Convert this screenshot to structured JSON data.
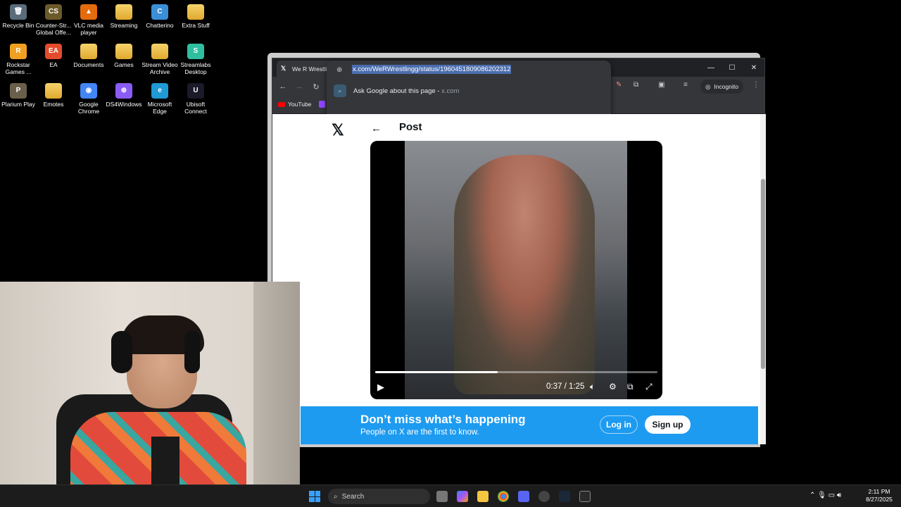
{
  "desktop": {
    "icons": [
      {
        "label": "Recycle Bin",
        "glyph": "🗑"
      },
      {
        "label": "Counter-Str... Global Offe...",
        "glyph": "CS"
      },
      {
        "label": "VLC media player",
        "glyph": "▲"
      },
      {
        "label": "Streaming",
        "glyph": ""
      },
      {
        "label": "Chatterino",
        "glyph": "C"
      },
      {
        "label": "Extra Stuff",
        "glyph": ""
      },
      {
        "label": "Rockstar Games ...",
        "glyph": "R"
      },
      {
        "label": "EA",
        "glyph": "EA"
      },
      {
        "label": "Documents",
        "glyph": ""
      },
      {
        "label": "Games",
        "glyph": ""
      },
      {
        "label": "Stream Video Archive",
        "glyph": ""
      },
      {
        "label": "Streamlabs Desktop",
        "glyph": "S"
      },
      {
        "label": "Plarium Play",
        "glyph": "P"
      },
      {
        "label": "Emotes",
        "glyph": ""
      },
      {
        "label": "Google Chrome",
        "glyph": "◉"
      },
      {
        "label": "DS4Windows",
        "glyph": "⊕"
      },
      {
        "label": "Microsoft Edge",
        "glyph": "e"
      },
      {
        "label": "Ubisoft Connect",
        "glyph": "U"
      }
    ]
  },
  "browser": {
    "tab_title": "We R Wrestling on X: \"Doug",
    "tab_audio_icon": "speaker-icon",
    "new_tab": "+",
    "window_controls": {
      "minimize": "—",
      "maximize": "☐",
      "close": "✕"
    },
    "url": "x.com/WeRWrestlingg/status/1960451809086202312",
    "suggestion": {
      "text": "Ask Google about this page",
      "separator": " - ",
      "domain": "x.com"
    },
    "incognito_label": "Incognito",
    "bookmark": "YouTube"
  },
  "page": {
    "header_title": "Post",
    "video": {
      "time": "0:37 / 1:25",
      "progress": 0.435
    },
    "banner": {
      "title": "Don’t miss what’s happening",
      "subtitle": "People on X are the first to know.",
      "login": "Log in",
      "signup": "Sign up"
    },
    "colors": {
      "x_blue": "#1d9bf0",
      "url_highlight": "#4b6dad"
    }
  },
  "taskbar": {
    "search_placeholder": "Search",
    "time": "2:11 PM",
    "date": "8/27/2025"
  }
}
